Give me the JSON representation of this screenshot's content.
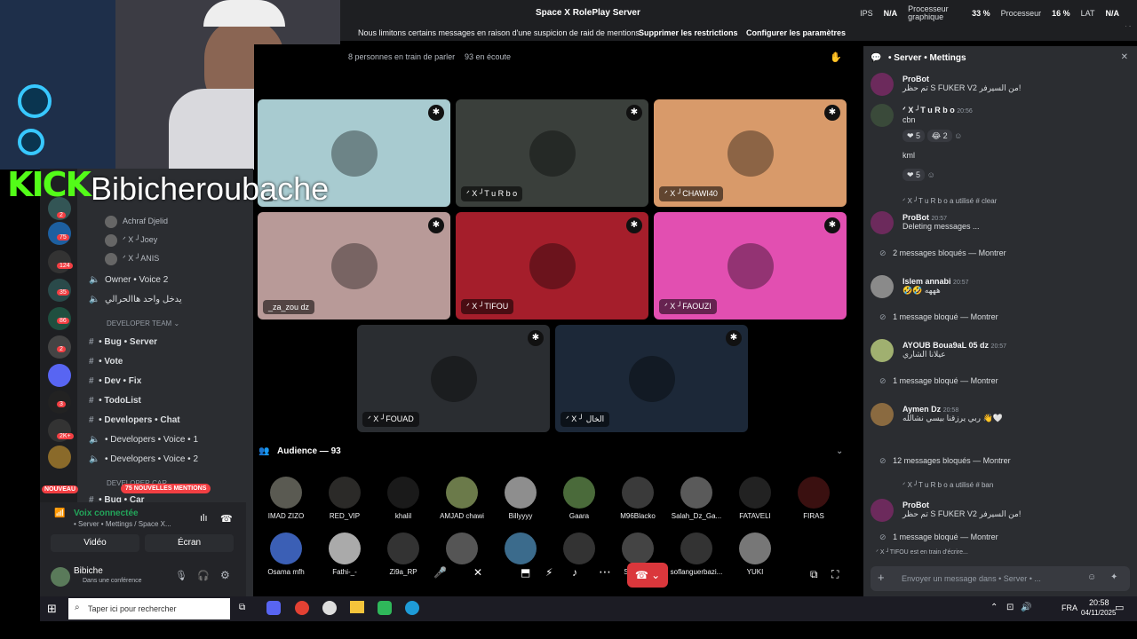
{
  "window_title": "Space X RolePlay Server",
  "perf": {
    "ips_label": "IPS",
    "ips_value": "N/A",
    "gpu_label": "Processeur graphique",
    "gpu_value": "33 %",
    "cpu_label": "Processeur",
    "cpu_value": "16 %",
    "lat_label": "LAT",
    "lat_value": "N/A"
  },
  "raid_notice": {
    "text": "Nous limitons certains messages en raison d'une suspicion de raid de mentions",
    "remove": "Supprimer les restrictions",
    "configure": "Configurer les paramètres"
  },
  "stage": {
    "speakers_info": "8 personnes en train de parler",
    "listeners_info": "93 en écoute",
    "audience_title": "Audience — 93"
  },
  "tiles": [
    {
      "name": "",
      "bg": "#a8cbd0"
    },
    {
      "name": "ᐟ X ╯T u R b o",
      "bg": "#3a3f3b"
    },
    {
      "name": "ᐟ X ╯CHAWI40",
      "bg": "#d89a6a"
    },
    {
      "name": "_za_zou dz",
      "bg": "#b89a98"
    },
    {
      "name": "ᐟ X ╯TIFOU",
      "bg": "#a51e2b"
    },
    {
      "name": "ᐟ X ╯FAOUZI",
      "bg": "#e24fb1"
    },
    {
      "name": "ᐟ X ╯FOUAD",
      "bg": "#2a2d31"
    },
    {
      "name": "ᐟ X ╯ الخال",
      "bg": "#1c2838"
    }
  ],
  "audience": [
    "IMAD ZIZO",
    "RED_VIP",
    "khalil",
    "AMJAD chawi",
    "Billyyyy",
    "Gaara",
    "M96Blacko",
    "Salah_Dz_Ga...",
    "FATAVELI",
    "FIRAS",
    "Osama mfh",
    "Fathi-_-",
    "Zi9a_RP",
    "",
    "",
    "",
    "Saphorix",
    "soflanguerbazi...",
    "YUKI"
  ],
  "chat": {
    "header": "• Server • Mettings",
    "messages": [
      {
        "user": "ProBot",
        "text": "تم حظر S FUKER V2 من السيرفر!"
      },
      {
        "user": "ᐟ X ╯T u R b o",
        "time": "20:56",
        "text": "cbn"
      },
      {
        "reaction": "5",
        "reaction2": "2"
      },
      {
        "text": "kml"
      },
      {
        "reaction": "5"
      },
      {
        "system": "ᐟ X ╯T u R b o a utilisé # clear"
      },
      {
        "user": "ProBot",
        "time": "20:57",
        "text": "Deleting messages ..."
      },
      {
        "blocked": "2 messages bloqués — Montrer"
      },
      {
        "user": "Islem annabi",
        "time": "20:57",
        "text": "🤣🤣 هههه"
      },
      {
        "blocked": "1 message bloqué — Montrer"
      },
      {
        "user": "AYOUB Boua9aL 05  dz",
        "time": "20:57",
        "text": "عيلانا الشاري"
      },
      {
        "blocked": "1 message bloqué — Montrer"
      },
      {
        "user": "Aymen Dz",
        "time": "20:58",
        "text": "ربي يرزقنا بيسي نشالله 👋🤍"
      },
      {
        "blocked": "12 messages bloqués — Montrer"
      },
      {
        "system": "ᐟ X ╯T u R b o a utilisé # ban"
      },
      {
        "user": "ProBot",
        "text": "تم حظر S FUKER V2 من السيرفر!"
      },
      {
        "blocked": "1 message bloqué — Montrer"
      },
      {
        "typing": "ᐟ X ╯TIFOU est en train d'écrire..."
      }
    ],
    "input_placeholder": "Envoyer un message dans • Server • ..."
  },
  "sidebar": {
    "voice_users": [
      "Achraf Djelid",
      "ᐟ X ╯Joey",
      "ᐟ X ╯ANIS"
    ],
    "channels": [
      {
        "label": "Owner • Voice 2",
        "kind": "voice"
      },
      {
        "label": "يدخل واحد هاالحرالي",
        "kind": "voice"
      },
      {
        "label": "DEVELOPER TEAM",
        "kind": "category"
      },
      {
        "label": "• Bug • Server",
        "kind": "text"
      },
      {
        "label": "• Vote",
        "kind": "text"
      },
      {
        "label": "• Dev • Fix",
        "kind": "text"
      },
      {
        "label": "• TodoList",
        "kind": "text"
      },
      {
        "label": "• Developers • Chat",
        "kind": "text"
      },
      {
        "label": "• Developers • Voice • 1",
        "kind": "voice"
      },
      {
        "label": "• Developers • Voice • 2",
        "kind": "voice"
      },
      {
        "label": "DEVELOPER CAR",
        "kind": "category"
      },
      {
        "label": "• Bug • Car",
        "kind": "text"
      }
    ],
    "mentions_pill": "75 NOUVELLES MENTIONS",
    "nouveau": "NOUVEAU",
    "voice_connected": "Voix connectée",
    "voice_channel": "• Server • Mettings / Space X...",
    "video_btn": "Vidéo",
    "screen_btn": "Écran",
    "user_name": "Bibiche",
    "user_status": "Dans une conférence",
    "badges": [
      "2",
      "75",
      "124",
      "35",
      "86",
      "2",
      "3",
      "2K+"
    ]
  },
  "stream": {
    "brand": "KICK",
    "streamer": "Bibicheroubache"
  },
  "taskbar": {
    "search_placeholder": "Taper ici pour rechercher",
    "lang": "FRA",
    "time": "20:58",
    "date": "04/11/2025"
  }
}
